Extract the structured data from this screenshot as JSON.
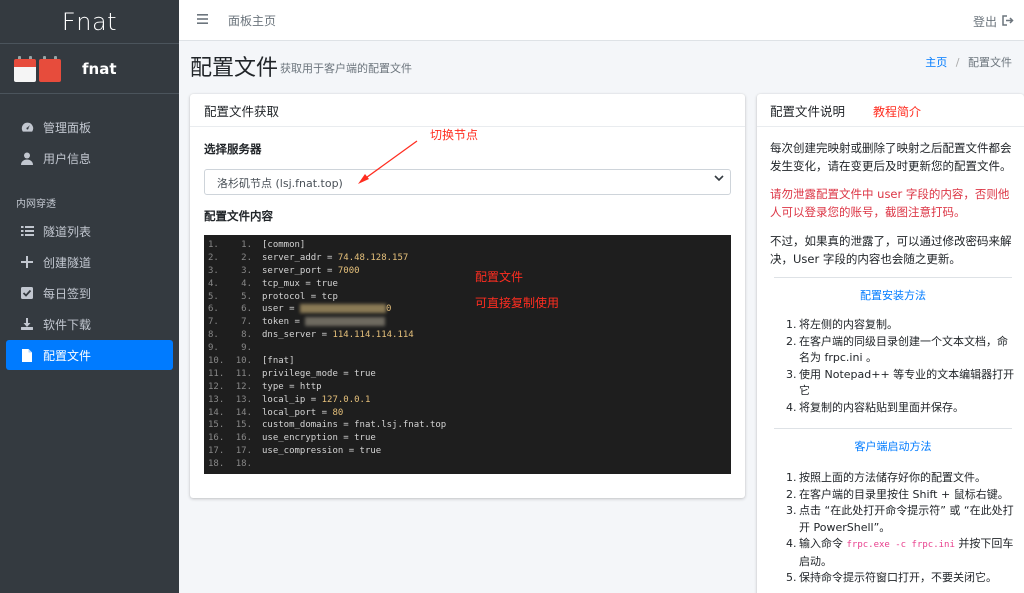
{
  "brand": {
    "logo": "Fnat"
  },
  "user": {
    "name": "fnat"
  },
  "nav": {
    "items": [
      {
        "label": "管理面板"
      },
      {
        "label": "用户信息"
      }
    ],
    "header": "内网穿透",
    "items2": [
      {
        "label": "隧道列表"
      },
      {
        "label": "创建隧道"
      },
      {
        "label": "每日签到"
      },
      {
        "label": "软件下载"
      },
      {
        "label": "配置文件"
      }
    ]
  },
  "topbar": {
    "title": "面板主页",
    "logout": "登出"
  },
  "page": {
    "title": "配置文件",
    "subtitle": "获取用于客户端的配置文件"
  },
  "breadcrumb": {
    "home": "主页",
    "sep": "/",
    "current": "配置文件"
  },
  "left_card": {
    "title": "配置文件获取",
    "server_label": "选择服务器",
    "server_value": "洛杉矶节点 (lsj.fnat.top)",
    "content_label": "配置文件内容",
    "code": [
      {
        "n": "1.",
        "text": "[common]"
      },
      {
        "n": "2.",
        "key": "server_addr = ",
        "val": "74.48.128.157"
      },
      {
        "n": "3.",
        "key": "server_port = ",
        "val": "7000"
      },
      {
        "n": "4.",
        "text": "tcp_mux = true"
      },
      {
        "n": "5.",
        "text": "protocol = tcp"
      },
      {
        "n": "6.",
        "key": "user = ",
        "blur": true,
        "tail": "0"
      },
      {
        "n": "7.",
        "key": "token = ",
        "blur2": true
      },
      {
        "n": "8.",
        "key": "dns_server = ",
        "val": "114.114.114.114"
      },
      {
        "n": "9.",
        "text": ""
      },
      {
        "n": "10.",
        "text": "[fnat]"
      },
      {
        "n": "11.",
        "text": "privilege_mode = true"
      },
      {
        "n": "12.",
        "text": "type = http"
      },
      {
        "n": "13.",
        "key": "local_ip = ",
        "val": "127.0.0.1"
      },
      {
        "n": "14.",
        "key": "local_port = ",
        "val": "80"
      },
      {
        "n": "15.",
        "text": "custom_domains = fnat.lsj.fnat.top"
      },
      {
        "n": "16.",
        "text": "use_encryption = true"
      },
      {
        "n": "17.",
        "text": "use_compression = true"
      },
      {
        "n": "18.",
        "text": ""
      }
    ]
  },
  "right_card": {
    "title": "配置文件说明",
    "p1": "每次创建完映射或删除了映射之后配置文件都会发生变化，请在变更后及时更新您的配置文件。",
    "p2": "请勿泄露配置文件中 user 字段的内容，否则他人可以登录您的账号，截图注意打码。",
    "p3": "不过，如果真的泄露了，可以通过修改密码来解决，User 字段的内容也会随之更新。",
    "sec1": "配置安装方法",
    "install": [
      "将左侧的内容复制。",
      "在客户端的同级目录创建一个文本文档，命名为 frpc.ini 。",
      "使用 Notepad++ 等专业的文本编辑器打开它",
      "将复制的内容粘贴到里面并保存。"
    ],
    "sec2": "客户端启动方法",
    "start": [
      "按照上面的方法储存好你的配置文件。",
      "在客户端的目录里按住 Shift + 鼠标右键。",
      "点击 “在此处打开命令提示符” 或 “在此处打开 PowerShell”。",
      "输入命令 ",
      "保持命令提示符窗口打开，不要关闭它。"
    ],
    "cmd": "frpc.exe -c frpc.ini",
    "cmd_after": " 并按下回车启动。"
  },
  "annotations": {
    "switch_node": "切换节点",
    "tutorial": "教程简介",
    "config_file": "配置文件",
    "copy_direct": "可直接复制使用"
  },
  "colors": {
    "sidebar": "#343a40",
    "active": "#007bff",
    "annotation": "#ff2d20",
    "code_bg": "#1e1e1e"
  }
}
